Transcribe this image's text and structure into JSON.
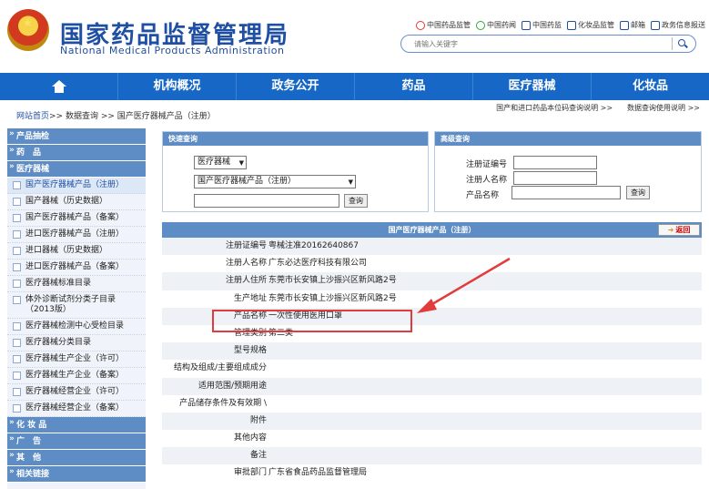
{
  "header": {
    "title": "国家药品监督管理局",
    "subtitle": "National Medical Products Administration",
    "links": [
      {
        "icon": "weibo-icon",
        "label": "中国药品监管"
      },
      {
        "icon": "wechat-icon",
        "label": "中国药闻"
      },
      {
        "icon": "phone-icon",
        "label": "中国药监"
      },
      {
        "icon": "phone-icon",
        "label": "化妆品监管"
      },
      {
        "icon": "mail-icon",
        "label": "邮箱"
      },
      {
        "icon": "monitor-icon",
        "label": "政务信息报送"
      }
    ],
    "search_placeholder": "请输入关键字"
  },
  "nav": {
    "items": [
      "机构概况",
      "政务公开",
      "药品",
      "医疗器械",
      "化妆品"
    ]
  },
  "breadcrumb": {
    "home": "网站首页",
    "trail": ">> 数据查询 >> 国产医疗器械产品（注册）"
  },
  "help_links": [
    "国产和进口药品本位码查询说明 >>",
    "数据查询使用说明 >>"
  ],
  "sidebar": {
    "sections": [
      {
        "title": "产品抽检",
        "items": []
      },
      {
        "title": "药　品",
        "items": []
      },
      {
        "title": "医疗器械",
        "items": [
          "国产医疗器械产品（注册）",
          "国产器械（历史数据）",
          "国产医疗器械产品（备案）",
          "进口医疗器械产品（注册）",
          "进口器械（历史数据）",
          "进口医疗器械产品（备案）",
          "医疗器械标准目录",
          "体外诊断试剂分类子目录（2013版）",
          "医疗器械检测中心受检目录",
          "医疗器械分类目录",
          "医疗器械生产企业（许可）",
          "医疗器械生产企业（备案）",
          "医疗器械经营企业（许可）",
          "医疗器械经营企业（备案）"
        ]
      },
      {
        "title": "化 妆 品",
        "items": []
      },
      {
        "title": "广　告",
        "items": []
      },
      {
        "title": "其　他",
        "items": []
      },
      {
        "title": "相关链接",
        "items": []
      }
    ]
  },
  "quick_query": {
    "title": "快速查询",
    "select1": "医疗器械",
    "select2": "国产医疗器械产品（注册）",
    "button": "查询"
  },
  "advanced_query": {
    "title": "高级查询",
    "fields": [
      "注册证编号",
      "注册人名称",
      "产品名称"
    ],
    "button": "查询"
  },
  "result": {
    "title": "国产医疗器械产品（注册）",
    "back": "返回",
    "rows": [
      {
        "k": "注册证编号",
        "v": "粤械注准20162640867"
      },
      {
        "k": "注册人名称",
        "v": "广东必达医疗科技有限公司"
      },
      {
        "k": "注册人住所",
        "v": "东莞市长安镇上沙振兴区新风路2号"
      },
      {
        "k": "生产地址",
        "v": "东莞市长安镇上沙振兴区新风路2号"
      },
      {
        "k": "产品名称",
        "v": "一次性使用医用口罩"
      },
      {
        "k": "管理类别",
        "v": "第二类"
      },
      {
        "k": "型号规格",
        "v": ""
      },
      {
        "k": "结构及组成/主要组成成分",
        "v": ""
      },
      {
        "k": "适用范围/预期用途",
        "v": ""
      },
      {
        "k": "产品储存条件及有效期 \\",
        "v": ""
      },
      {
        "k": "附件",
        "v": ""
      },
      {
        "k": "其他内容",
        "v": ""
      },
      {
        "k": "备注",
        "v": ""
      },
      {
        "k": "审批部门",
        "v": "广东省食品药品监督管理局"
      }
    ]
  },
  "colors": {
    "nav_blue": "#1667c6",
    "header_blue": "#5e8cc5",
    "highlight_red": "#e23b3b"
  }
}
